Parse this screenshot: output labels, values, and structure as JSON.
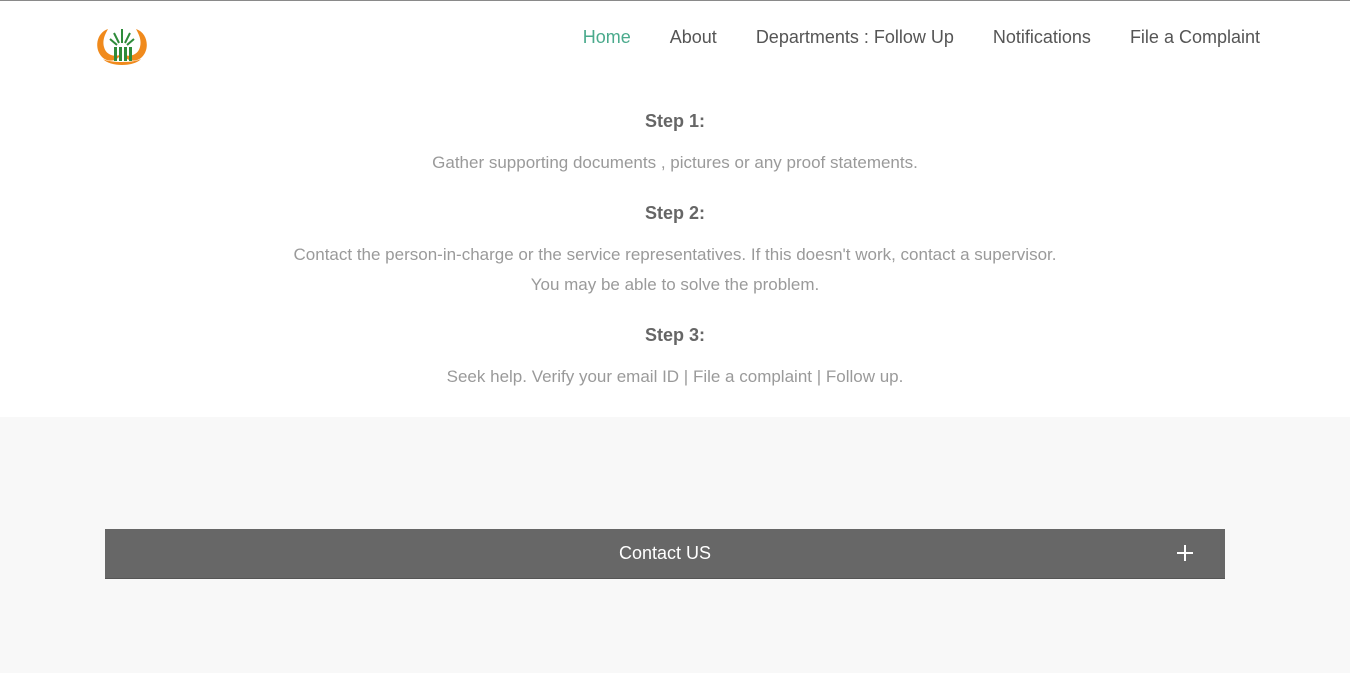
{
  "nav": {
    "items": [
      {
        "label": "Home",
        "active": true
      },
      {
        "label": "About",
        "active": false
      },
      {
        "label": "Departments : Follow Up",
        "active": false
      },
      {
        "label": "Notifications",
        "active": false
      },
      {
        "label": "File a Complaint",
        "active": false
      }
    ]
  },
  "logo": {
    "icon": "emblem-logo-icon",
    "colors": [
      "#f08a1c",
      "#2e8b3a"
    ]
  },
  "steps": [
    {
      "title": "Step 1:",
      "lines": [
        "Gather supporting documents , pictures or any proof statements."
      ]
    },
    {
      "title": "Step 2:",
      "lines": [
        "Contact the person-in-charge or the service representatives. If this doesn't work, contact a supervisor.",
        "You may be able to solve the problem."
      ]
    },
    {
      "title": "Step 3:",
      "lines": [
        "Seek help. Verify your email ID | File a complaint | Follow up."
      ]
    }
  ],
  "contact": {
    "label": "Contact US",
    "icon": "plus-icon"
  },
  "colors": {
    "accent": "#4aaa8c",
    "bar": "#676767",
    "muted_text": "#9a9a9a"
  }
}
